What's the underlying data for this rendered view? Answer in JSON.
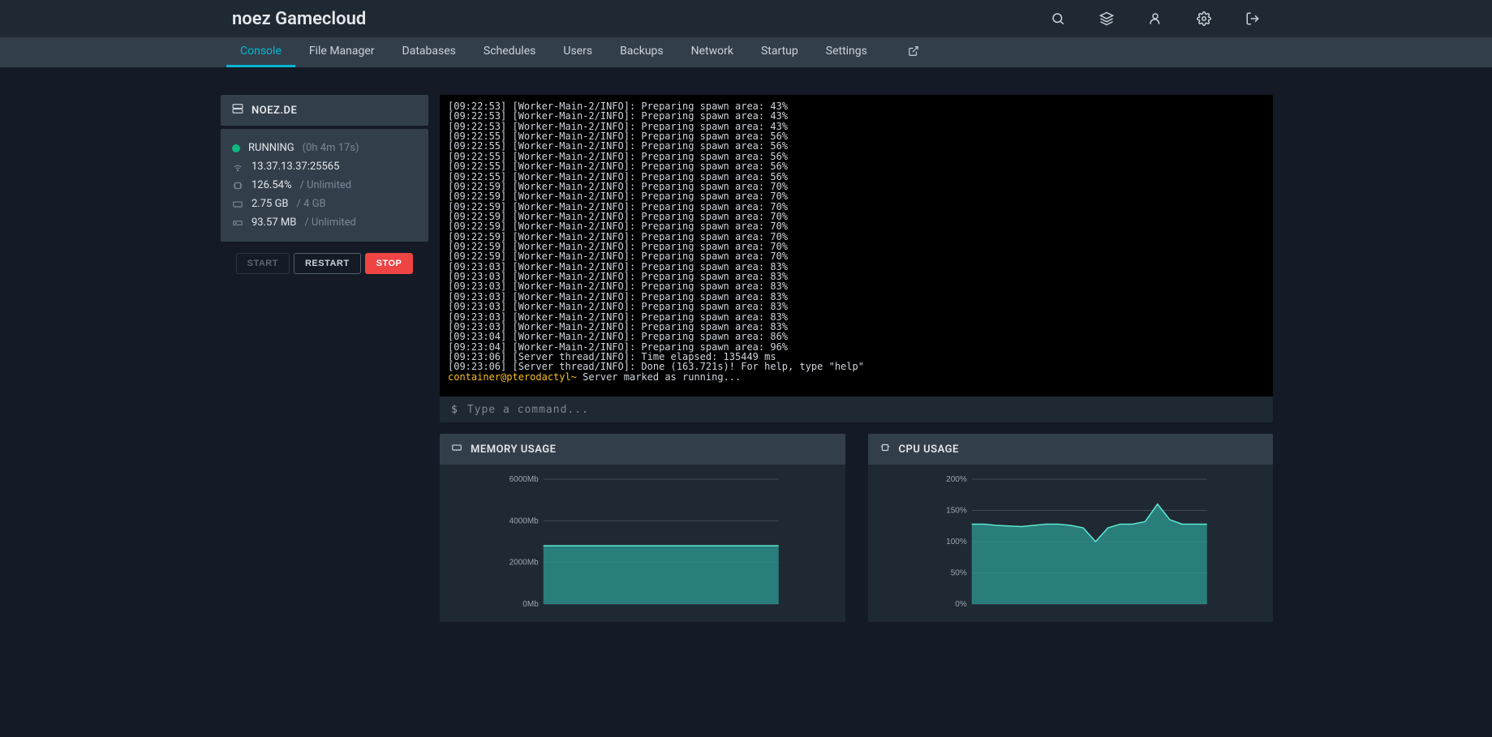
{
  "brand": "noez Gamecloud",
  "nav": {
    "items": [
      {
        "label": "Console",
        "active": true
      },
      {
        "label": "File Manager"
      },
      {
        "label": "Databases"
      },
      {
        "label": "Schedules"
      },
      {
        "label": "Users"
      },
      {
        "label": "Backups"
      },
      {
        "label": "Network"
      },
      {
        "label": "Startup"
      },
      {
        "label": "Settings"
      }
    ]
  },
  "server": {
    "name": "NOEZ.DE",
    "status": "RUNNING",
    "uptime": "(0h 4m 17s)",
    "address": "13.37.13.37:25565",
    "cpu_value": "126.54%",
    "cpu_limit": "/ Unlimited",
    "mem_value": "2.75 GB",
    "mem_limit": "/ 4 GB",
    "disk_value": "93.57 MB",
    "disk_limit": "/ Unlimited"
  },
  "buttons": {
    "start": "START",
    "restart": "RESTART",
    "stop": "STOP"
  },
  "console": {
    "placeholder": "Type a command...",
    "prompt_symbol": "$",
    "prompt_host": "container@pterodactyl~",
    "prompt_msg": "Server marked as running...",
    "lines": [
      "[09:22:53] [Worker-Main-2/INFO]: Preparing spawn area: 43%",
      "[09:22:53] [Worker-Main-2/INFO]: Preparing spawn area: 43%",
      "[09:22:53] [Worker-Main-2/INFO]: Preparing spawn area: 43%",
      "[09:22:55] [Worker-Main-2/INFO]: Preparing spawn area: 56%",
      "[09:22:55] [Worker-Main-2/INFO]: Preparing spawn area: 56%",
      "[09:22:55] [Worker-Main-2/INFO]: Preparing spawn area: 56%",
      "[09:22:55] [Worker-Main-2/INFO]: Preparing spawn area: 56%",
      "[09:22:55] [Worker-Main-2/INFO]: Preparing spawn area: 56%",
      "[09:22:59] [Worker-Main-2/INFO]: Preparing spawn area: 70%",
      "[09:22:59] [Worker-Main-2/INFO]: Preparing spawn area: 70%",
      "[09:22:59] [Worker-Main-2/INFO]: Preparing spawn area: 70%",
      "[09:22:59] [Worker-Main-2/INFO]: Preparing spawn area: 70%",
      "[09:22:59] [Worker-Main-2/INFO]: Preparing spawn area: 70%",
      "[09:22:59] [Worker-Main-2/INFO]: Preparing spawn area: 70%",
      "[09:22:59] [Worker-Main-2/INFO]: Preparing spawn area: 70%",
      "[09:22:59] [Worker-Main-2/INFO]: Preparing spawn area: 70%",
      "[09:23:03] [Worker-Main-2/INFO]: Preparing spawn area: 83%",
      "[09:23:03] [Worker-Main-2/INFO]: Preparing spawn area: 83%",
      "[09:23:03] [Worker-Main-2/INFO]: Preparing spawn area: 83%",
      "[09:23:03] [Worker-Main-2/INFO]: Preparing spawn area: 83%",
      "[09:23:03] [Worker-Main-2/INFO]: Preparing spawn area: 83%",
      "[09:23:03] [Worker-Main-2/INFO]: Preparing spawn area: 83%",
      "[09:23:03] [Worker-Main-2/INFO]: Preparing spawn area: 83%",
      "[09:23:04] [Worker-Main-2/INFO]: Preparing spawn area: 86%",
      "[09:23:04] [Worker-Main-2/INFO]: Preparing spawn area: 96%",
      "[09:23:06] [Server thread/INFO]: Time elapsed: 135449 ms",
      "[09:23:06] [Server thread/INFO]: Done (163.721s)! For help, type \"help\""
    ]
  },
  "charts": {
    "memory": {
      "title": "MEMORY USAGE"
    },
    "cpu": {
      "title": "CPU USAGE"
    }
  },
  "chart_data": [
    {
      "type": "area",
      "title": "MEMORY USAGE",
      "ylabel": "Mb",
      "ylim": [
        0,
        6000
      ],
      "yticks": [
        "0Mb",
        "2000Mb",
        "4000Mb",
        "6000Mb"
      ],
      "x": [
        0,
        1,
        2,
        3,
        4,
        5,
        6,
        7,
        8,
        9,
        10,
        11,
        12,
        13,
        14,
        15,
        16,
        17,
        18,
        19
      ],
      "values": [
        2800,
        2800,
        2800,
        2800,
        2800,
        2800,
        2800,
        2800,
        2800,
        2800,
        2800,
        2800,
        2800,
        2800,
        2800,
        2800,
        2800,
        2800,
        2800,
        2800
      ]
    },
    {
      "type": "area",
      "title": "CPU USAGE",
      "ylabel": "%",
      "ylim": [
        0,
        200
      ],
      "yticks": [
        "0%",
        "50%",
        "100%",
        "150%",
        "200%"
      ],
      "x": [
        0,
        1,
        2,
        3,
        4,
        5,
        6,
        7,
        8,
        9,
        10,
        11,
        12,
        13,
        14,
        15,
        16,
        17,
        18,
        19
      ],
      "values": [
        128,
        128,
        126,
        125,
        124,
        126,
        128,
        128,
        126,
        122,
        100,
        122,
        128,
        128,
        132,
        160,
        135,
        128,
        128,
        128
      ]
    }
  ]
}
